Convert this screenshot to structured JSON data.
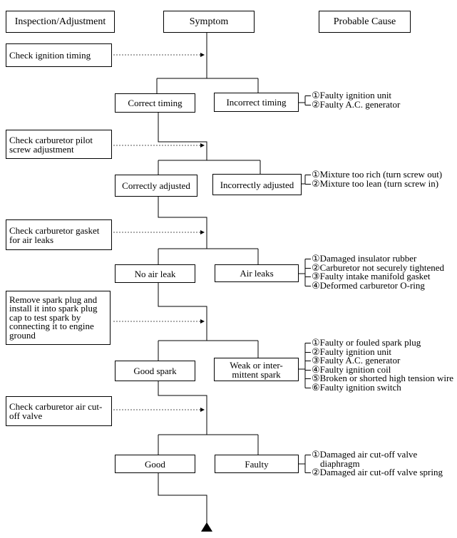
{
  "headers": {
    "inspection": "Inspection/Adjustment",
    "symptom": "Symptom",
    "cause": "Probable Cause"
  },
  "steps": [
    {
      "inspection": "Check ignition timing",
      "ok": "Correct timing",
      "ng": "Incorrect timing",
      "causes": [
        "①Faulty ignition unit",
        "②Faulty A.C. generator"
      ]
    },
    {
      "inspection": "Check carburetor pilot screw adjustment",
      "ok": "Correctly adjusted",
      "ng": "Incorrectly adjusted",
      "causes": [
        "①Mixture too rich (turn screw out)",
        "②Mixture too lean (turn screw in)"
      ]
    },
    {
      "inspection": "Check carburetor gasket for air leaks",
      "ok": "No air leak",
      "ng": "Air leaks",
      "causes": [
        "①Damaged insulator rubber",
        "②Carburetor not securely tightened",
        "③Faulty intake manifold gasket",
        "④Deformed carburetor O-ring"
      ]
    },
    {
      "inspection": "Remove spark plug and install it into spark plug cap to test spark by connecting it to engine ground",
      "ok": "Good spark",
      "ng": "Weak or inter-mittent spark",
      "causes": [
        "①Faulty or fouled spark plug",
        "②Faulty ignition unit",
        "③Faulty A.C. generator",
        "④Faulty ignition coil",
        "⑤Broken or shorted high tension wire",
        "⑥Faulty ignition switch"
      ]
    },
    {
      "inspection": "Check carburetor air cut-off valve",
      "ok": "Good",
      "ng": "Faulty",
      "causes": [
        "①Damaged air cut-off valve diaphragm",
        "②Damaged air cut-off valve spring"
      ]
    }
  ],
  "colors": {
    "line": "#000000",
    "dashed": "#555555"
  }
}
